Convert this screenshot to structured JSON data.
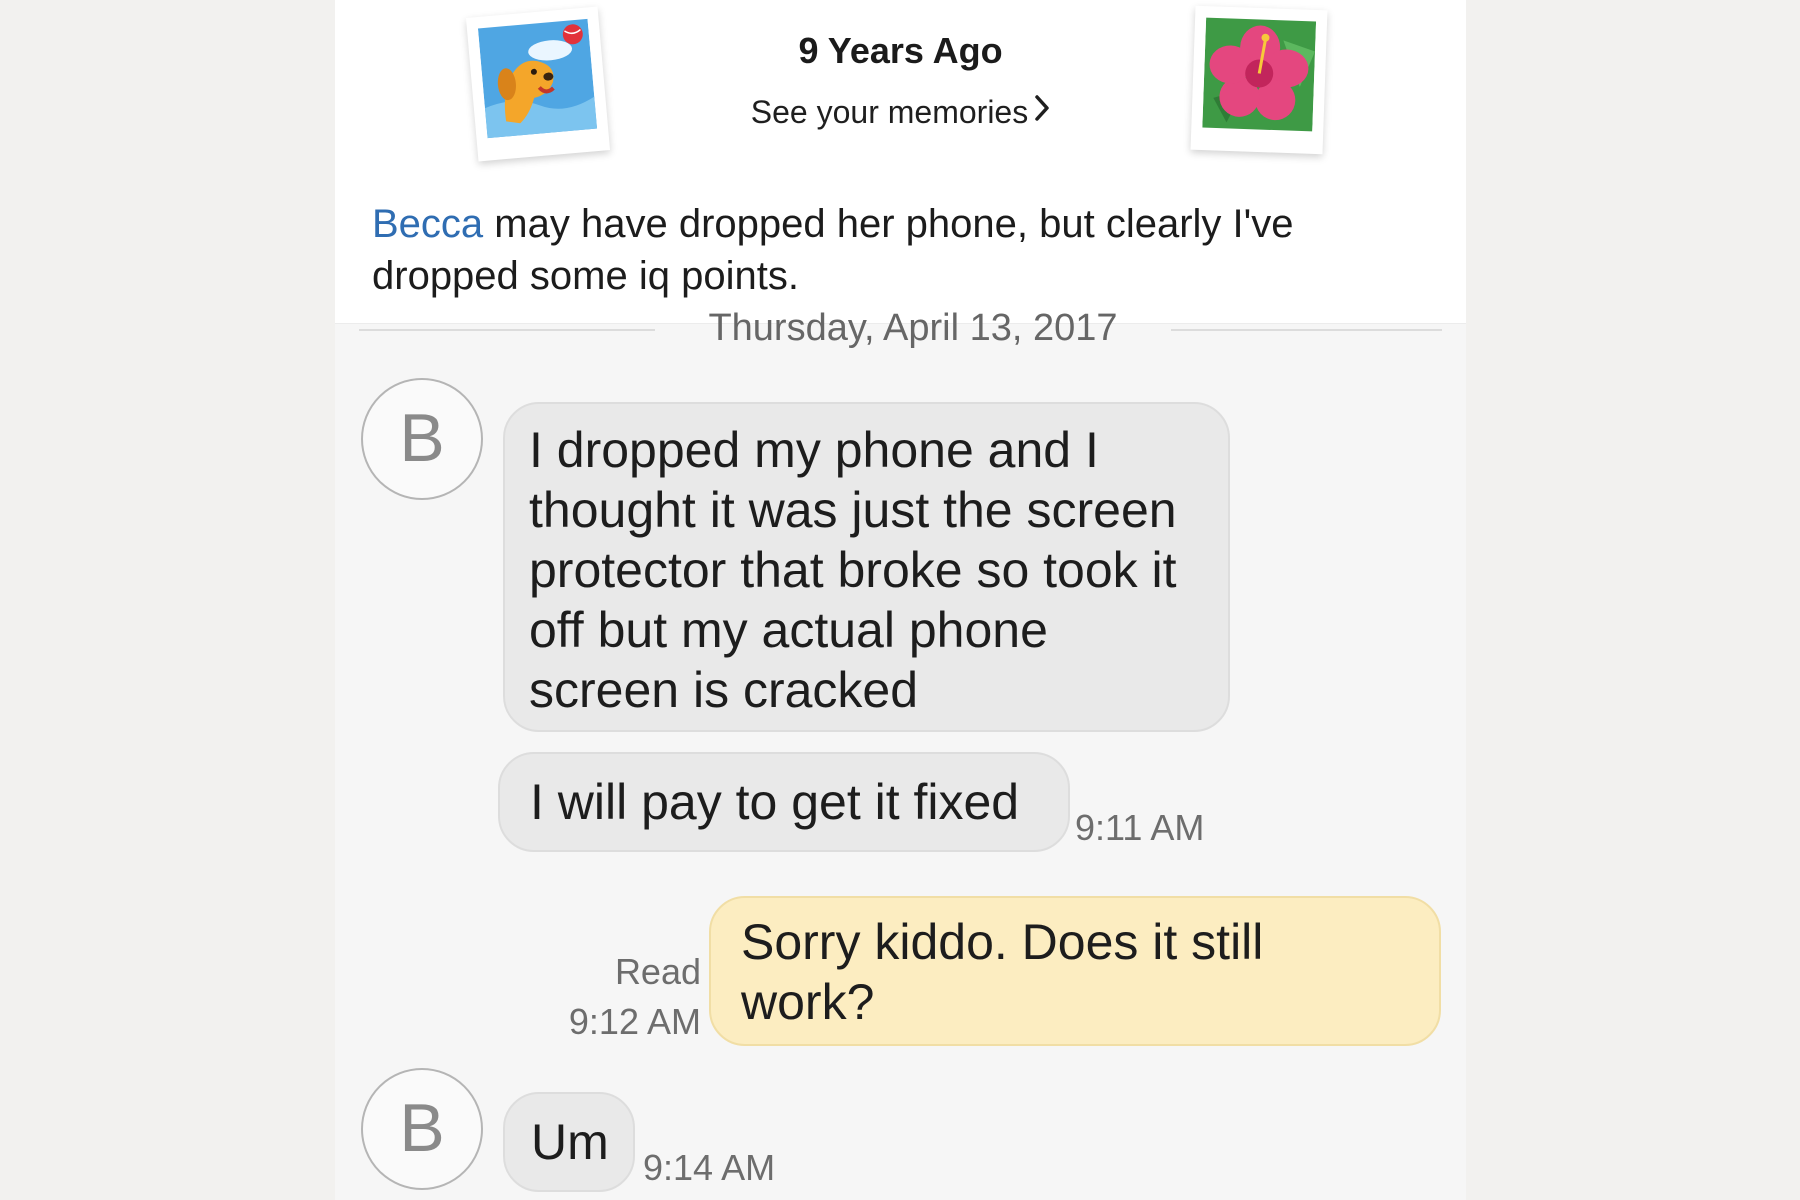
{
  "memory": {
    "title": "9 Years Ago",
    "link_label": "See your memories",
    "caption_name": "Becca",
    "caption_text": " may have dropped her phone, but clearly I've dropped some iq points."
  },
  "conversation": {
    "date_divider": "Thursday, April 13, 2017",
    "contact_initial": "B",
    "messages": [
      {
        "sender": "contact",
        "text": "I dropped my phone and I thought it was just the screen protector that broke so took it off but my actual phone screen is cracked"
      },
      {
        "sender": "contact",
        "text": "I will pay to get it fixed",
        "time": "9:11 AM"
      },
      {
        "sender": "me",
        "text": "Sorry kiddo. Does it still work?",
        "status": "Read",
        "time": "9:12 AM"
      },
      {
        "sender": "contact",
        "text": "Um",
        "time": "9:14 AM"
      }
    ]
  },
  "colors": {
    "incoming_bubble": "#e9e9e9",
    "outgoing_bubble": "#fcedc1",
    "name_link": "#2f6db2"
  },
  "icons": [
    "dog-polaroid-icon",
    "hibiscus-polaroid-icon",
    "chevron-right-icon"
  ]
}
